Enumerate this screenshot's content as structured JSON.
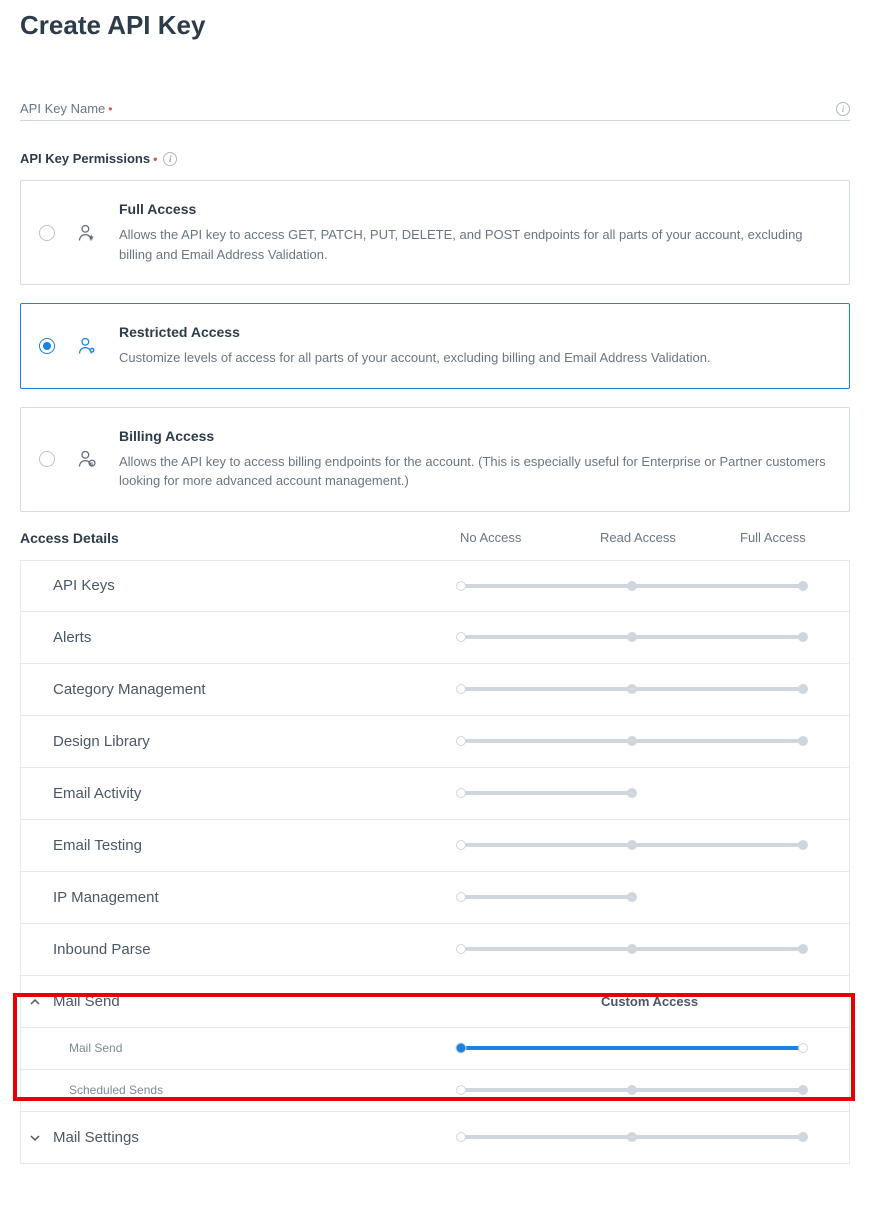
{
  "page": {
    "title": "Create API Key"
  },
  "fields": {
    "api_key_name": {
      "label": "API Key Name"
    },
    "permissions": {
      "label": "API Key Permissions"
    }
  },
  "permission_options": {
    "full": {
      "title": "Full Access",
      "desc": "Allows the API key to access GET, PATCH, PUT, DELETE, and POST endpoints for all parts of your account, excluding billing and Email Address Validation."
    },
    "restricted": {
      "title": "Restricted Access",
      "desc": "Customize levels of access for all parts of your account, excluding billing and Email Address Validation."
    },
    "billing": {
      "title": "Billing Access",
      "desc": "Allows the API key to access billing endpoints for the account. (This is especially useful for Enterprise or Partner customers looking for more advanced account management.)"
    }
  },
  "details": {
    "heading": "Access Details",
    "columns": {
      "none": "No Access",
      "read": "Read Access",
      "full": "Full Access"
    },
    "rows": {
      "api_keys": "API Keys",
      "alerts": "Alerts",
      "category": "Category Management",
      "design": "Design Library",
      "email_activity": "Email Activity",
      "email_testing": "Email Testing",
      "ip": "IP Management",
      "inbound": "Inbound Parse",
      "mail_send": "Mail Send",
      "mail_send_sub": "Mail Send",
      "scheduled": "Scheduled Sends",
      "mail_settings": "Mail Settings"
    },
    "custom_label": "Custom Access"
  },
  "colors": {
    "brand": "#1a82e2",
    "highlight": "#e60000"
  }
}
